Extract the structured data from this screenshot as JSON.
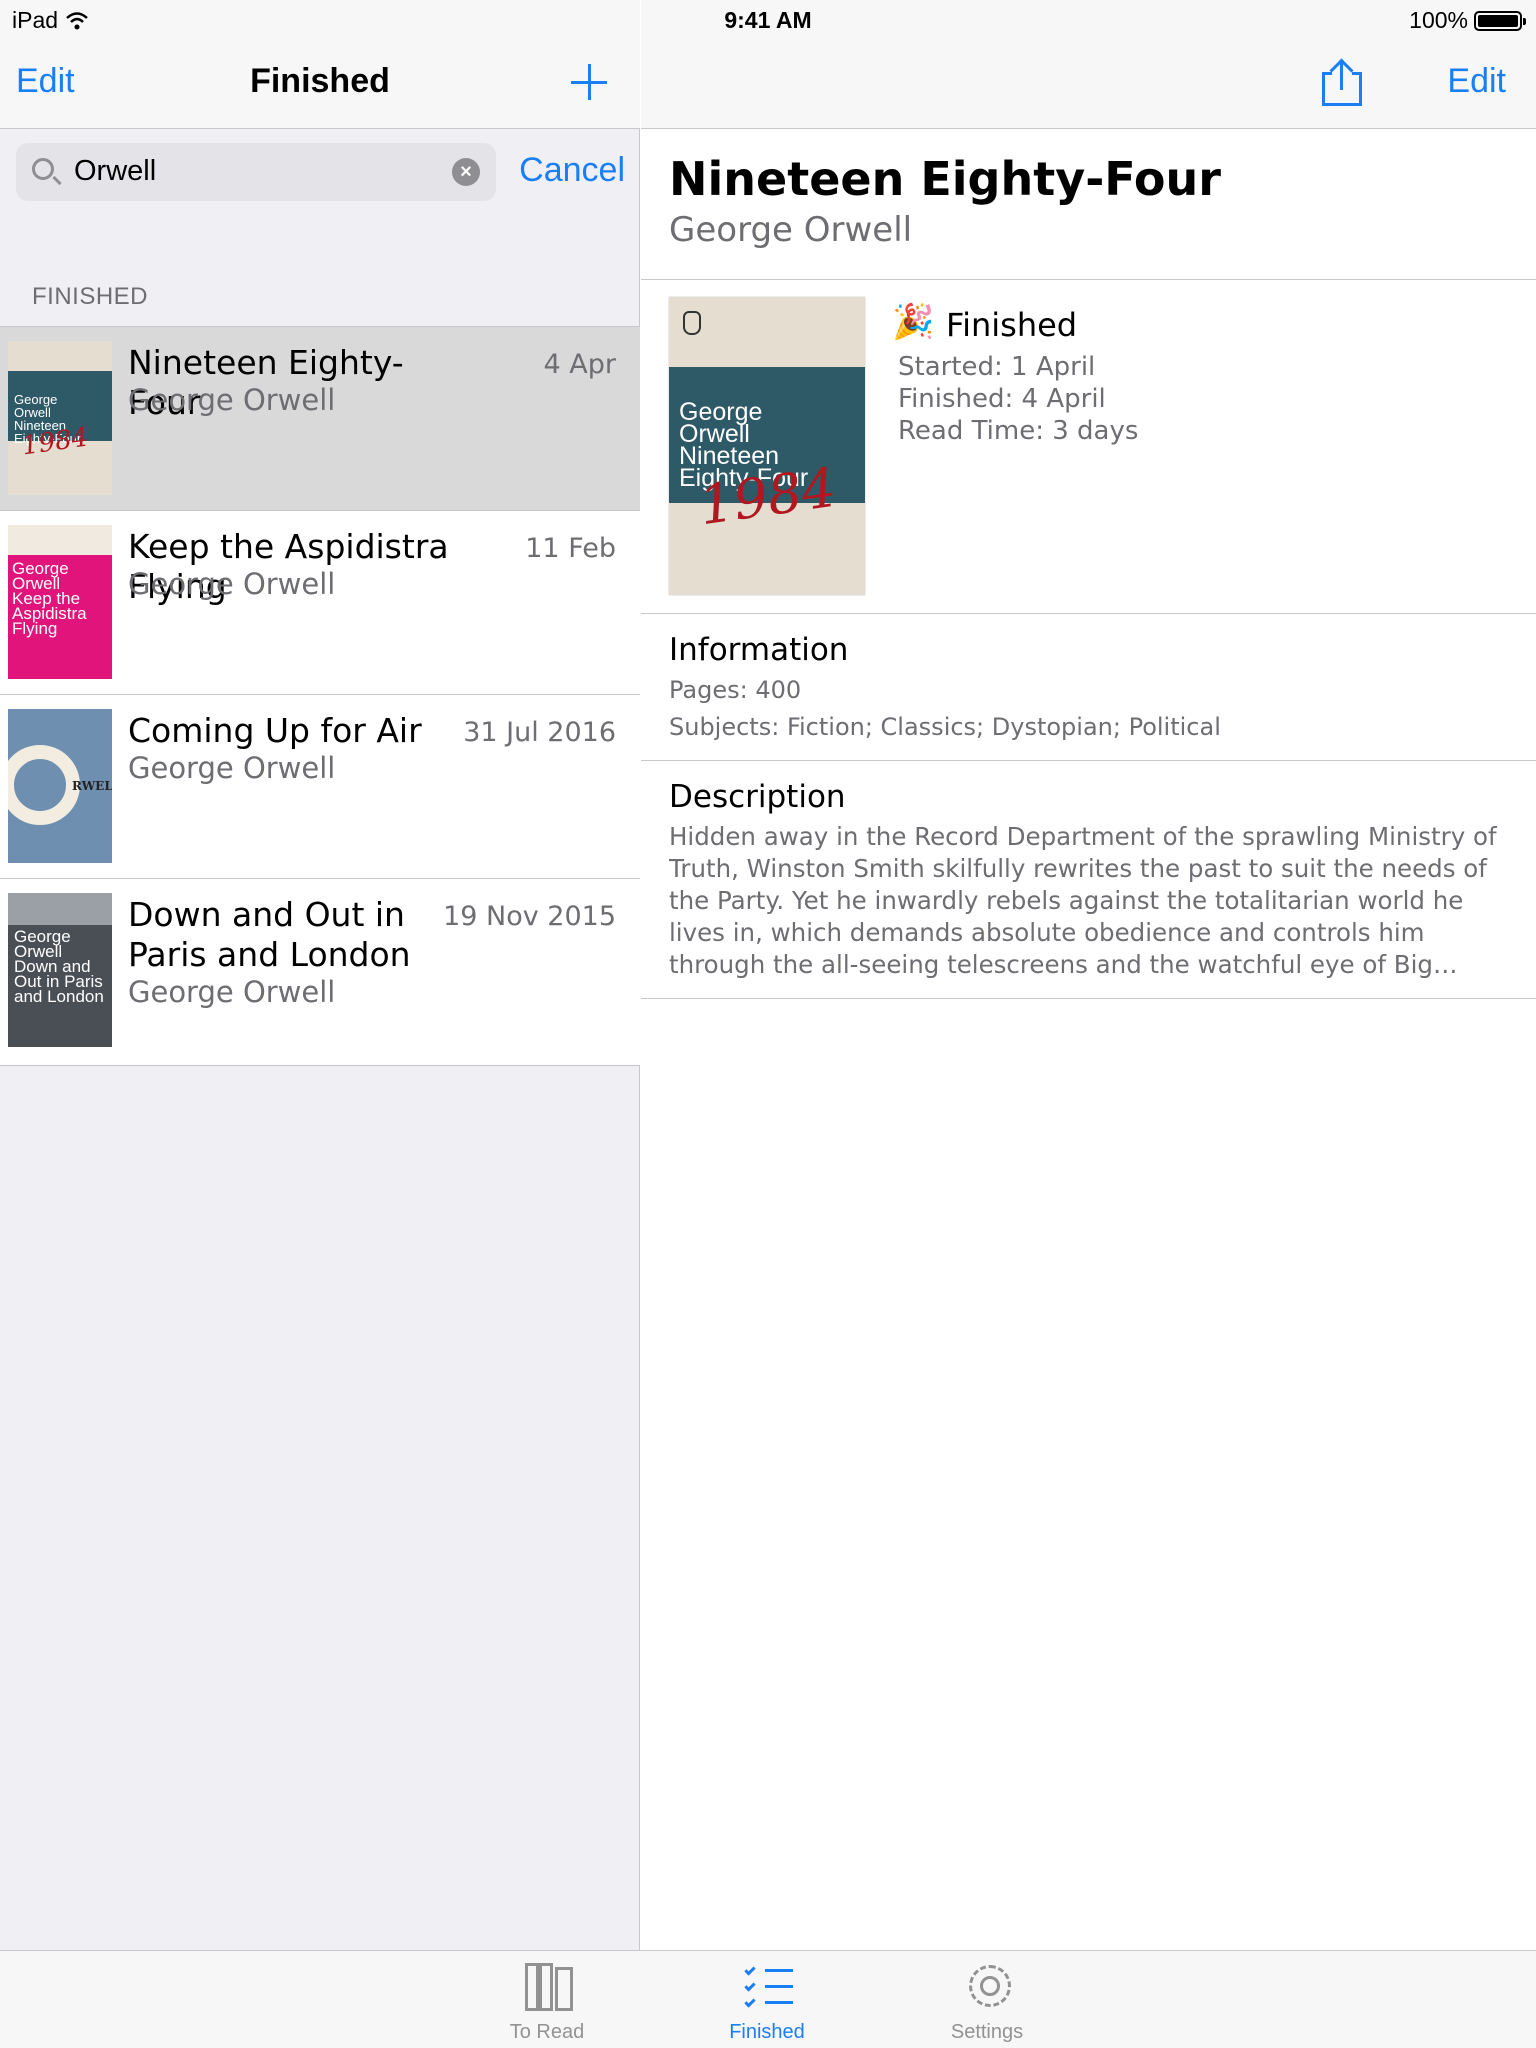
{
  "status_bar": {
    "device": "iPad",
    "time": "9:41 AM",
    "battery": "100%",
    "battery_level": 1.0
  },
  "left_nav": {
    "edit_label": "Edit",
    "title": "Finished",
    "add_icon": "plus-icon"
  },
  "search": {
    "value": "Orwell",
    "clear_glyph": "×",
    "cancel_label": "Cancel"
  },
  "section_header": "FINISHED",
  "books": [
    {
      "title": "Nineteen Eighty-Four",
      "author": "George Orwell",
      "date": "4 Apr",
      "selected": true,
      "cover_text": [
        "George",
        "Orwell",
        "Nineteen",
        "Eighty-Four"
      ],
      "cover_mark": "1984"
    },
    {
      "title": "Keep the Aspidistra Flying",
      "author": "George Orwell",
      "date": "11 Feb",
      "selected": false,
      "cover_text": [
        "George",
        "Orwell",
        "Keep the",
        "Aspidistra",
        "Flying"
      ]
    },
    {
      "title": "Coming Up for Air",
      "author": "George Orwell",
      "date": "31 Jul 2016",
      "selected": false,
      "cover_text": [
        "RWELL"
      ]
    },
    {
      "title": "Down and Out in Paris and London",
      "author": "George Orwell",
      "date": "19 Nov 2015",
      "selected": false,
      "cover_text": [
        "George",
        "Orwell",
        "Down and",
        "Out in Paris",
        "and London"
      ]
    }
  ],
  "right_nav": {
    "share_icon": "share-icon",
    "edit_label": "Edit"
  },
  "detail": {
    "title": "Nineteen Eighty-Four",
    "author": "George Orwell",
    "cover_text": [
      "George",
      "Orwell",
      "Nineteen",
      "Eighty-Four"
    ],
    "cover_mark": "1984",
    "status_icon": "🎉",
    "status_label": "Finished",
    "started": "Started: 1 April",
    "finished": "Finished: 4 April",
    "read_time": "Read Time: 3 days",
    "info_title": "Information",
    "pages": "Pages: 400",
    "subjects": "Subjects: Fiction; Classics; Dystopian; Political",
    "description_title": "Description",
    "description": "Hidden away in the Record Department of the sprawling Ministry of Truth, Winston Smith skilfully rewrites the past to suit the needs of the Party. Yet he inwardly rebels against the totalitarian world he lives in, which demands absolute obedience and controls him through the all-seeing telescreens and the watchful eye of Big Brother, symbolic head o…"
  },
  "tabs": [
    {
      "label": "To Read",
      "icon": "books-icon",
      "active": false
    },
    {
      "label": "Finished",
      "icon": "checklist-icon",
      "active": true
    },
    {
      "label": "Settings",
      "icon": "gear-icon",
      "active": false
    }
  ],
  "colors": {
    "accent": "#1a7ff5",
    "secondary_text": "#6d6d72",
    "selected_row": "#d9d9d9",
    "background": "#efeff4"
  }
}
